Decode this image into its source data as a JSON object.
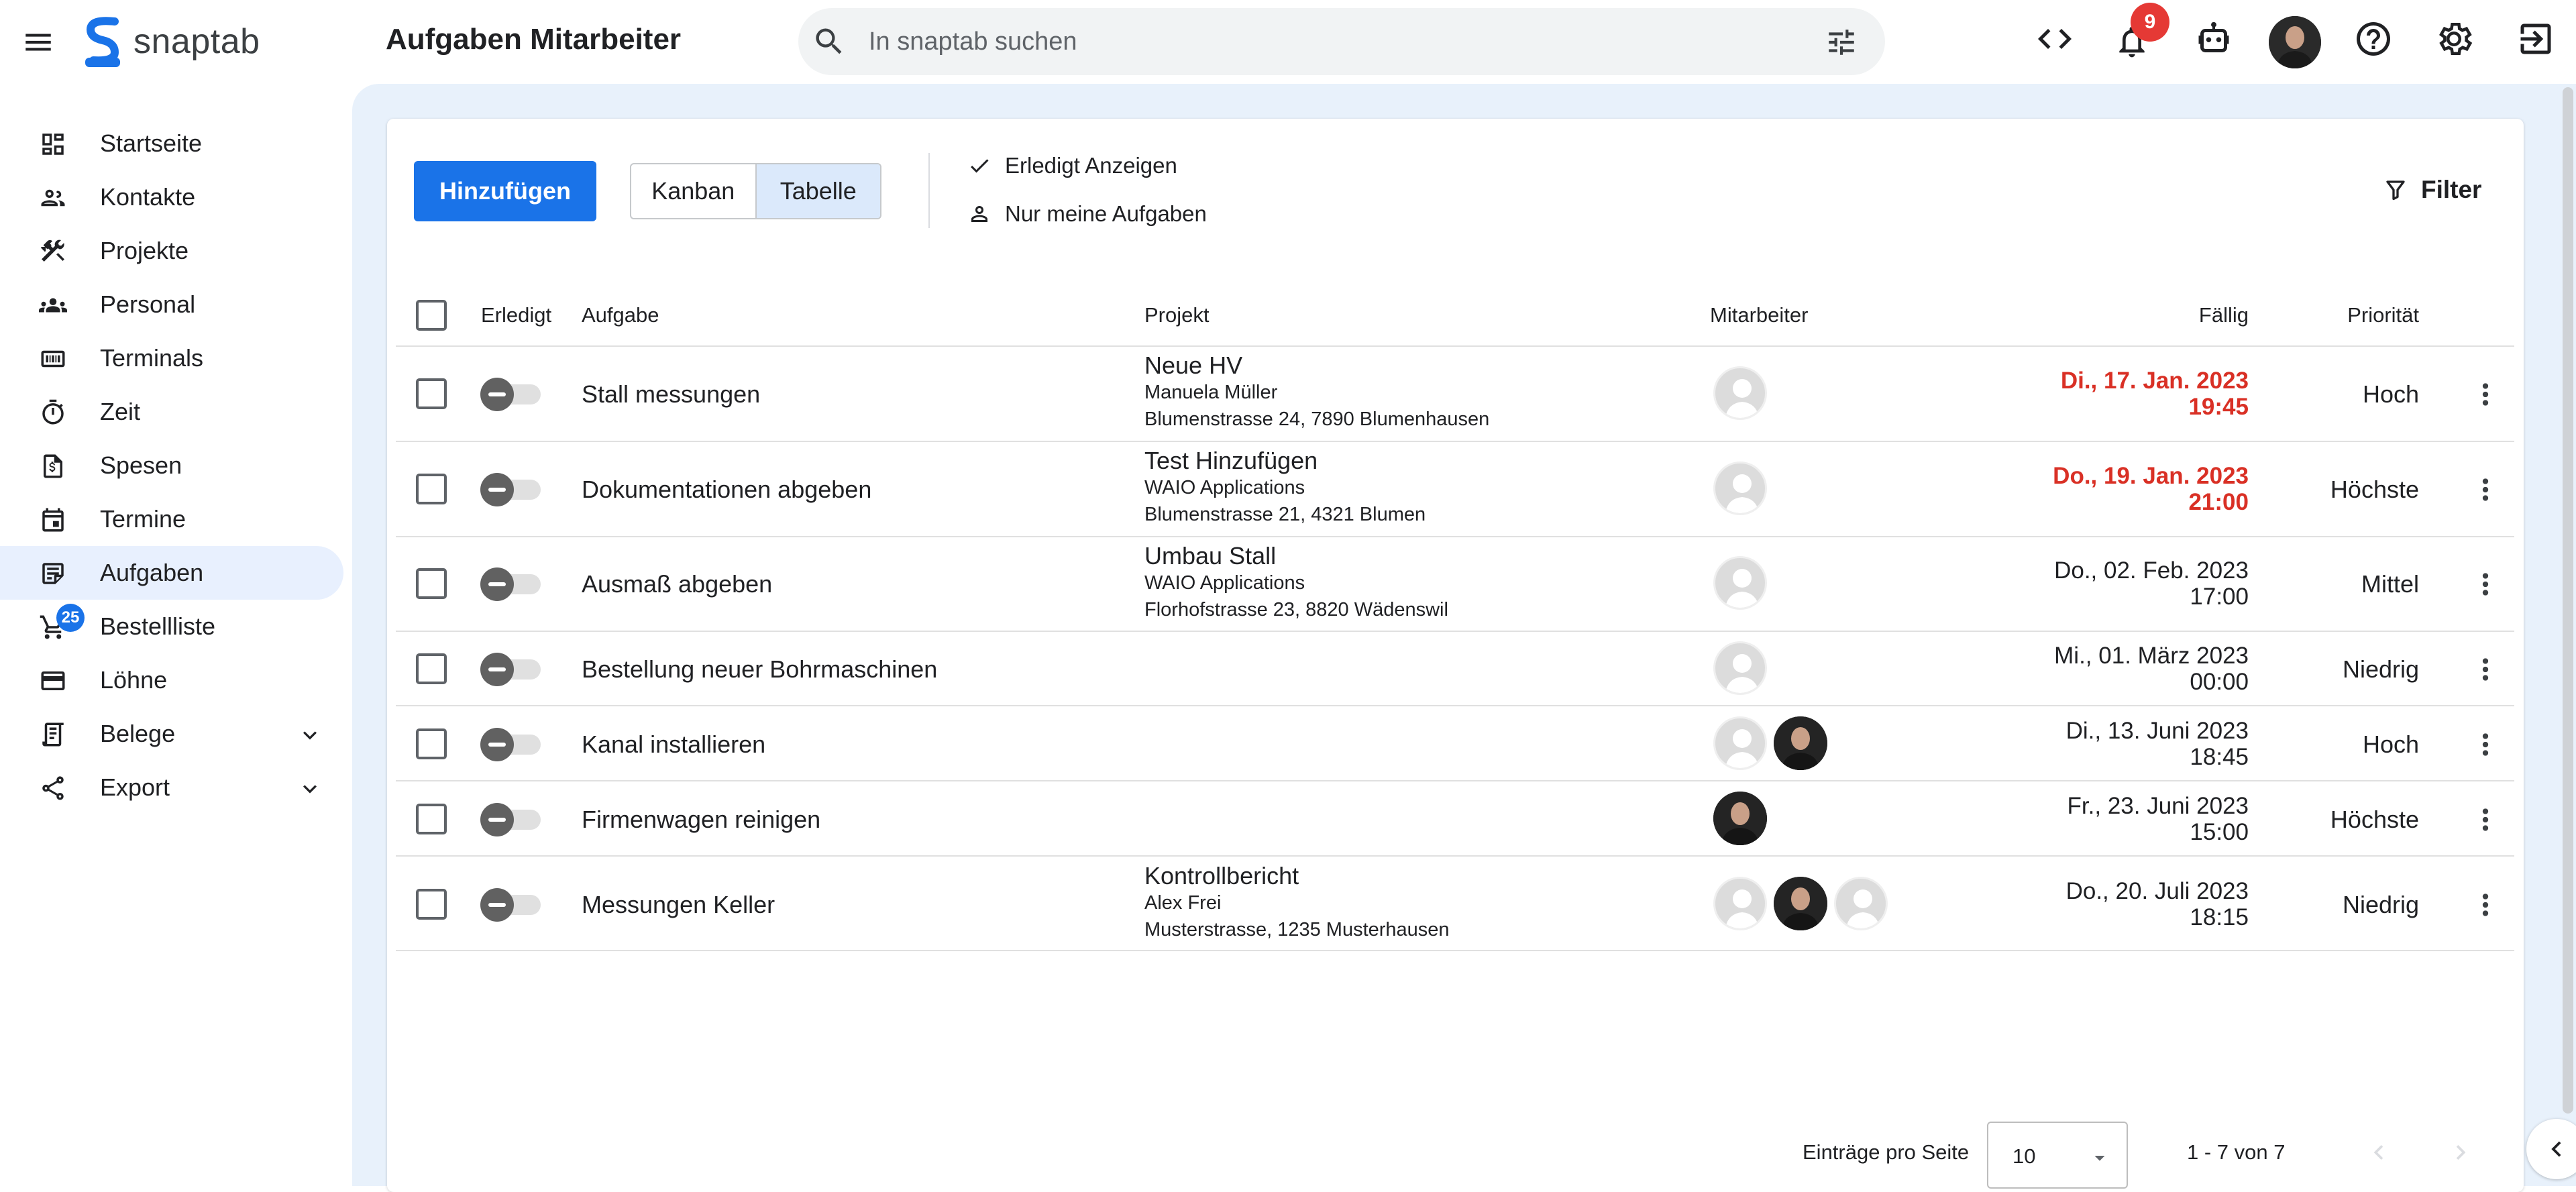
{
  "app": {
    "name": "snaptab",
    "page_title": "Aufgaben Mitarbeiter"
  },
  "search": {
    "placeholder": "In snaptab suchen"
  },
  "header": {
    "notifications_count": "9"
  },
  "sidebar": {
    "items": [
      {
        "label": "Startseite",
        "icon": "dashboard-icon"
      },
      {
        "label": "Kontakte",
        "icon": "contacts-icon"
      },
      {
        "label": "Projekte",
        "icon": "tools-icon"
      },
      {
        "label": "Personal",
        "icon": "people-icon"
      },
      {
        "label": "Terminals",
        "icon": "terminal-icon"
      },
      {
        "label": "Zeit",
        "icon": "timer-icon"
      },
      {
        "label": "Spesen",
        "icon": "receipt-icon"
      },
      {
        "label": "Termine",
        "icon": "calendar-icon"
      },
      {
        "label": "Aufgaben",
        "icon": "task-icon",
        "active": true
      },
      {
        "label": "Bestellliste",
        "icon": "cart-icon",
        "badge": "25"
      },
      {
        "label": "Löhne",
        "icon": "payment-icon"
      },
      {
        "label": "Belege",
        "icon": "document-icon",
        "expandable": true
      },
      {
        "label": "Export",
        "icon": "share-icon",
        "expandable": true
      }
    ]
  },
  "toolbar": {
    "add_label": "Hinzufügen",
    "view_kanban": "Kanban",
    "view_table": "Tabelle",
    "show_done": "Erledigt Anzeigen",
    "only_mine": "Nur meine Aufgaben",
    "filter_label": "Filter"
  },
  "table": {
    "headers": {
      "done": "Erledigt",
      "task": "Aufgabe",
      "project": "Projekt",
      "employee": "Mitarbeiter",
      "due": "Fällig",
      "priority": "Priorität"
    },
    "rows": [
      {
        "task": "Stall messungen",
        "project_title": "Neue HV",
        "project_client": "Manuela Müller",
        "project_address": "Blumenstrasse 24, 7890 Blumenhausen",
        "employees": [
          "placeholder"
        ],
        "due_date": "Di., 17. Jan. 2023",
        "due_time": "19:45",
        "overdue": true,
        "priority": "Hoch"
      },
      {
        "task": "Dokumentationen abgeben",
        "project_title": "Test Hinzufügen",
        "project_client": "WAIO Applications",
        "project_address": "Blumenstrasse 21, 4321 Blumen",
        "employees": [
          "placeholder"
        ],
        "due_date": "Do., 19. Jan. 2023",
        "due_time": "21:00",
        "overdue": true,
        "priority": "Höchste"
      },
      {
        "task": "Ausmaß abgeben",
        "project_title": "Umbau Stall",
        "project_client": "WAIO Applications",
        "project_address": "Florhofstrasse 23, 8820 Wädenswil",
        "employees": [
          "placeholder"
        ],
        "due_date": "Do., 02. Feb. 2023",
        "due_time": "17:00",
        "overdue": false,
        "priority": "Mittel"
      },
      {
        "task": "Bestellung neuer Bohrmaschinen",
        "project_title": "",
        "project_client": "",
        "project_address": "",
        "employees": [
          "placeholder"
        ],
        "due_date": "Mi., 01. März 2023",
        "due_time": "00:00",
        "overdue": false,
        "priority": "Niedrig"
      },
      {
        "task": "Kanal installieren",
        "project_title": "",
        "project_client": "",
        "project_address": "",
        "employees": [
          "placeholder",
          "photo"
        ],
        "due_date": "Di., 13. Juni 2023",
        "due_time": "18:45",
        "overdue": false,
        "priority": "Hoch"
      },
      {
        "task": "Firmenwagen reinigen",
        "project_title": "",
        "project_client": "",
        "project_address": "",
        "employees": [
          "photo"
        ],
        "due_date": "Fr., 23. Juni 2023",
        "due_time": "15:00",
        "overdue": false,
        "priority": "Höchste"
      },
      {
        "task": "Messungen Keller",
        "project_title": "Kontrollbericht",
        "project_client": "Alex Frei",
        "project_address": "Musterstrasse, 1235 Musterhausen",
        "employees": [
          "placeholder",
          "photo",
          "placeholder"
        ],
        "due_date": "Do., 20. Juli 2023",
        "due_time": "18:15",
        "overdue": false,
        "priority": "Niedrig"
      }
    ]
  },
  "pagination": {
    "per_page_label": "Einträge pro Seite",
    "per_page_value": "10",
    "range": "1 - 7 von 7"
  },
  "colors": {
    "accent": "#1a73e8",
    "overdue": "#d93025",
    "main_bg": "#e8f1fb"
  }
}
